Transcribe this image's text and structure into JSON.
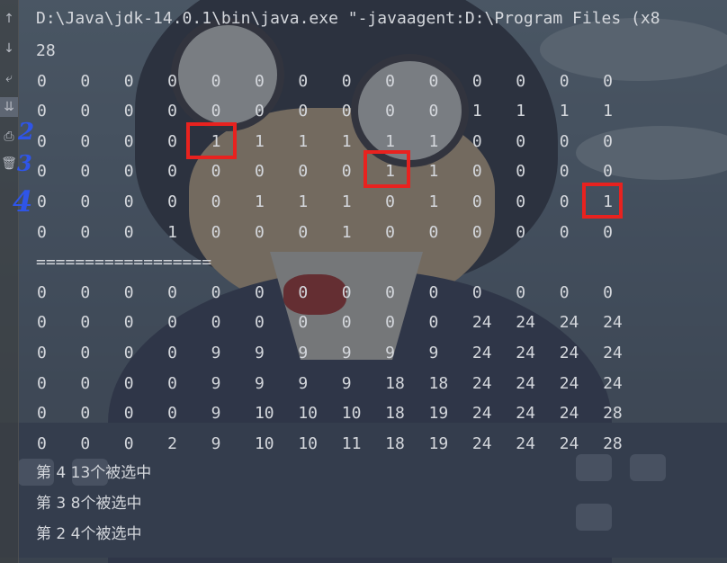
{
  "console": {
    "command": "D:\\Java\\jdk-14.0.1\\bin\\java.exe \"-javaagent:D:\\Program Files (x8",
    "capacity": "28",
    "table_a": [
      [
        "0",
        "0",
        "0",
        "0",
        "0",
        "0",
        "0",
        "0",
        "0",
        "0",
        "0",
        "0",
        "0",
        "0"
      ],
      [
        "0",
        "0",
        "0",
        "0",
        "0",
        "0",
        "0",
        "0",
        "0",
        "0",
        "1",
        "1",
        "1",
        "1"
      ],
      [
        "0",
        "0",
        "0",
        "0",
        "1",
        "1",
        "1",
        "1",
        "1",
        "1",
        "0",
        "0",
        "0",
        "0"
      ],
      [
        "0",
        "0",
        "0",
        "0",
        "0",
        "0",
        "0",
        "0",
        "1",
        "1",
        "0",
        "0",
        "0",
        "0"
      ],
      [
        "0",
        "0",
        "0",
        "0",
        "0",
        "1",
        "1",
        "1",
        "0",
        "1",
        "0",
        "0",
        "0",
        "1"
      ],
      [
        "0",
        "0",
        "0",
        "1",
        "0",
        "0",
        "0",
        "1",
        "0",
        "0",
        "0",
        "0",
        "0",
        "0"
      ]
    ],
    "separator": "==================",
    "table_b": [
      [
        "0",
        "0",
        "0",
        "0",
        "0",
        "0",
        "0",
        "0",
        "0",
        "0",
        "0",
        "0",
        "0",
        "0"
      ],
      [
        "0",
        "0",
        "0",
        "0",
        "0",
        "0",
        "0",
        "0",
        "0",
        "0",
        "24",
        "24",
        "24",
        "24"
      ],
      [
        "0",
        "0",
        "0",
        "0",
        "9",
        "9",
        "9",
        "9",
        "9",
        "9",
        "24",
        "24",
        "24",
        "24"
      ],
      [
        "0",
        "0",
        "0",
        "0",
        "9",
        "9",
        "9",
        "9",
        "18",
        "18",
        "24",
        "24",
        "24",
        "24"
      ],
      [
        "0",
        "0",
        "0",
        "0",
        "9",
        "10",
        "10",
        "10",
        "18",
        "19",
        "24",
        "24",
        "24",
        "28"
      ],
      [
        "0",
        "0",
        "0",
        "2",
        "9",
        "10",
        "10",
        "11",
        "18",
        "19",
        "24",
        "24",
        "24",
        "28"
      ]
    ],
    "results": [
      "第 4 13个被选中",
      "第 3 8个被选中",
      "第 2 4个被选中"
    ]
  },
  "gutter": {
    "buttons": [
      {
        "name": "scroll-up-icon",
        "glyph": "↑"
      },
      {
        "name": "scroll-down-icon",
        "glyph": "↓"
      },
      {
        "name": "soft-wrap-icon",
        "glyph": "⤶"
      },
      {
        "name": "scroll-to-end-icon",
        "glyph": "⇊"
      },
      {
        "name": "print-icon",
        "glyph": "⎙"
      },
      {
        "name": "clear-all-icon",
        "glyph": "🗑"
      }
    ]
  },
  "annotations": {
    "numbers": [
      "2",
      "3",
      "4"
    ],
    "mark_color": "#e8221f",
    "hand_color": "#2f55e8"
  }
}
